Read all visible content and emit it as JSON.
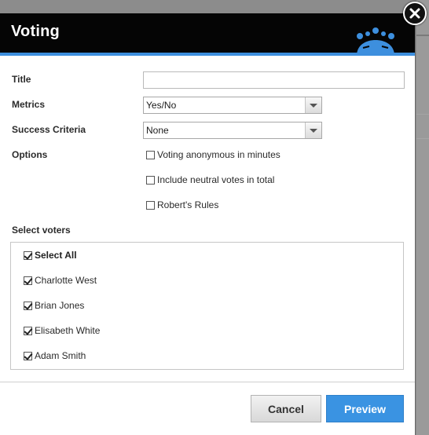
{
  "dialog": {
    "title": "Voting",
    "close_icon": "close-icon",
    "logo_icon": "crown-logo-icon",
    "accent_color": "#3d8fde"
  },
  "form": {
    "title_label": "Title",
    "title_value": "",
    "metrics_label": "Metrics",
    "metrics_value": "Yes/No",
    "success_label": "Success Criteria",
    "success_value": "None",
    "options_label": "Options",
    "options": [
      {
        "label": "Voting anonymous in minutes",
        "checked": false
      },
      {
        "label": "Include neutral votes in total",
        "checked": false
      },
      {
        "label": "Robert's Rules",
        "checked": false
      }
    ]
  },
  "voters": {
    "label": "Select voters",
    "select_all": {
      "label": "Select All",
      "checked": true
    },
    "list": [
      {
        "name": "Charlotte West",
        "checked": true
      },
      {
        "name": "Brian Jones",
        "checked": true
      },
      {
        "name": "Elisabeth White",
        "checked": true
      },
      {
        "name": "Adam Smith",
        "checked": true
      }
    ]
  },
  "actions": {
    "cancel_label": "Cancel",
    "preview_label": "Preview",
    "preview_color": "#3a93e2"
  }
}
